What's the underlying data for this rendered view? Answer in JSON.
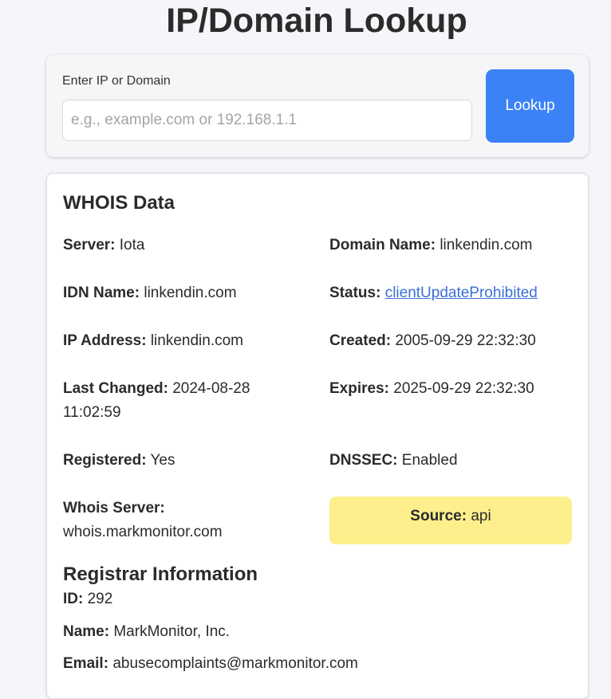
{
  "page": {
    "title": "IP/Domain Lookup"
  },
  "search": {
    "label": "Enter IP or Domain",
    "placeholder": "e.g., example.com or 192.168.1.1",
    "value": "",
    "button_label": "Lookup"
  },
  "whois": {
    "title": "WHOIS Data",
    "fields": {
      "server": {
        "label": "Server:",
        "value": "Iota"
      },
      "domain_name": {
        "label": "Domain Name:",
        "value": "linkendin.com"
      },
      "idn_name": {
        "label": "IDN Name:",
        "value": "linkendin.com"
      },
      "status": {
        "label": "Status:",
        "value": "clientUpdateProhibited"
      },
      "ip_address": {
        "label": "IP Address:",
        "value": "linkendin.com"
      },
      "created": {
        "label": "Created:",
        "value": "2005-09-29 22:32:30"
      },
      "last_changed": {
        "label": "Last Changed:",
        "value": "2024-08-28 11:02:59",
        "value_line1": "2024-08-28",
        "value_line2": "11:02:59"
      },
      "expires": {
        "label": "Expires:",
        "value": "2025-09-29 22:32:30"
      },
      "registered": {
        "label": "Registered:",
        "value": "Yes"
      },
      "dnssec": {
        "label": "DNSSEC:",
        "value": "Enabled"
      },
      "whois_server": {
        "label": "Whois Server:",
        "value": "whois.markmonitor.com"
      },
      "source": {
        "label": "Source:",
        "value": "api"
      }
    }
  },
  "registrar": {
    "title": "Registrar Information",
    "fields": {
      "id": {
        "label": "ID:",
        "value": "292"
      },
      "name": {
        "label": "Name:",
        "value": "MarkMonitor, Inc."
      },
      "email": {
        "label": "Email:",
        "value": "abusecomplaints@markmonitor.com"
      }
    }
  },
  "colors": {
    "accent": "#3b82f6",
    "source_highlight": "#fdf08c",
    "link": "#3b6fd4"
  }
}
